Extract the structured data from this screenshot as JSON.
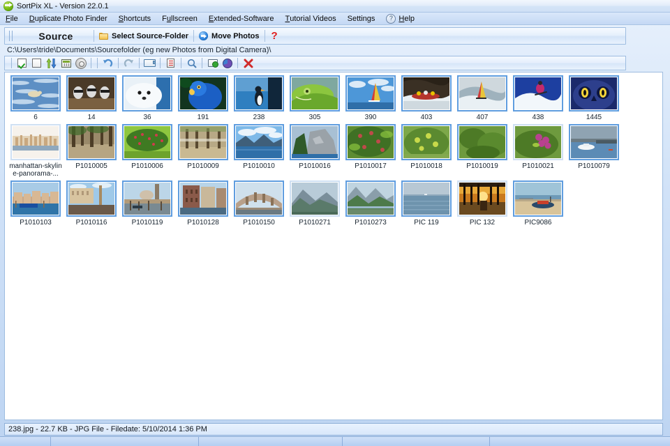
{
  "window": {
    "title": "SortPix XL - Version 22.0.1",
    "app_icon": "green-arrow-icon"
  },
  "menubar": {
    "items": [
      {
        "label": "File",
        "accel": "F"
      },
      {
        "label": "Duplicate Photo Finder",
        "accel": "D"
      },
      {
        "label": "Shortcuts",
        "accel": "S"
      },
      {
        "label": "Fullscreen",
        "accel": "u"
      },
      {
        "label": "Extended-Software",
        "accel": "E"
      },
      {
        "label": "Tutorial Videos",
        "accel": "T"
      },
      {
        "label": "Settings",
        "accel": "g"
      },
      {
        "label": "Help",
        "accel": "H",
        "icon": "question-circle-icon"
      }
    ]
  },
  "sourcebar": {
    "title": "Source",
    "select_folder_label": "Select Source-Folder",
    "move_photos_label": "Move Photos",
    "help_marker": "?"
  },
  "path": {
    "value": "C:\\Users\\tride\\Documents\\Sourcefolder (eg new Photos from Digital Camera)\\"
  },
  "toolbar": {
    "buttons": [
      {
        "name": "select-all-icon",
        "title": "Select All"
      },
      {
        "name": "deselect-all-icon",
        "title": "Deselect All"
      },
      {
        "name": "sort-updown-icon",
        "title": "Sort"
      },
      {
        "name": "table-view-icon",
        "title": "List View"
      },
      {
        "name": "slideshow-icon",
        "title": "Slideshow"
      },
      {
        "name": "undo-icon",
        "title": "Undo"
      },
      {
        "name": "redo-icon",
        "title": "Redo"
      },
      {
        "name": "rename-icon",
        "title": "Rename"
      },
      {
        "name": "report-icon",
        "title": "Report"
      },
      {
        "name": "zoom-icon",
        "title": "Preview"
      },
      {
        "name": "copy-confirm-icon",
        "title": "Copy"
      },
      {
        "name": "pie-chart-icon",
        "title": "Statistics"
      },
      {
        "name": "delete-icon",
        "title": "Delete"
      }
    ]
  },
  "thumbnails": {
    "rows": [
      [
        {
          "label": "6",
          "selected": true
        },
        {
          "label": "14",
          "selected": true
        },
        {
          "label": "36",
          "selected": true
        },
        {
          "label": "191",
          "selected": true
        },
        {
          "label": "238",
          "selected": true
        },
        {
          "label": "305",
          "selected": true
        },
        {
          "label": "390",
          "selected": true
        },
        {
          "label": "403",
          "selected": true
        },
        {
          "label": "407",
          "selected": true
        },
        {
          "label": "438",
          "selected": true
        },
        {
          "label": "1445",
          "selected": true
        }
      ],
      [
        {
          "label": "manhattan-skyline-panorama-...",
          "selected": false
        },
        {
          "label": "P1010005",
          "selected": true
        },
        {
          "label": "P1010006",
          "selected": true
        },
        {
          "label": "P1010009",
          "selected": true
        },
        {
          "label": "P1010010",
          "selected": true
        },
        {
          "label": "P1010016",
          "selected": true
        },
        {
          "label": "P1010017",
          "selected": true
        },
        {
          "label": "P1010018",
          "selected": true
        },
        {
          "label": "P1010019",
          "selected": true
        },
        {
          "label": "P1010021",
          "selected": false
        },
        {
          "label": "P1010079",
          "selected": true
        }
      ],
      [
        {
          "label": "P1010103",
          "selected": true
        },
        {
          "label": "P1010116",
          "selected": true
        },
        {
          "label": "P1010119",
          "selected": true
        },
        {
          "label": "P1010128",
          "selected": true
        },
        {
          "label": "P1010150",
          "selected": true
        },
        {
          "label": "P1010271",
          "selected": false
        },
        {
          "label": "P1010273",
          "selected": true
        },
        {
          "label": "PIC 119",
          "selected": true
        },
        {
          "label": "PIC 132",
          "selected": false
        },
        {
          "label": "PIC9086",
          "selected": true
        }
      ]
    ]
  },
  "status": {
    "text": "238.jpg - 22.7 KB - JPG File - Filedate: 5/10/2014 1:36 PM"
  },
  "colors": {
    "accent": "#5f9ddf",
    "chrome": "#c6daf6",
    "panel": "#ffffff",
    "selection_border": "#5f9ddf",
    "red_marker": "#e01b1b"
  }
}
